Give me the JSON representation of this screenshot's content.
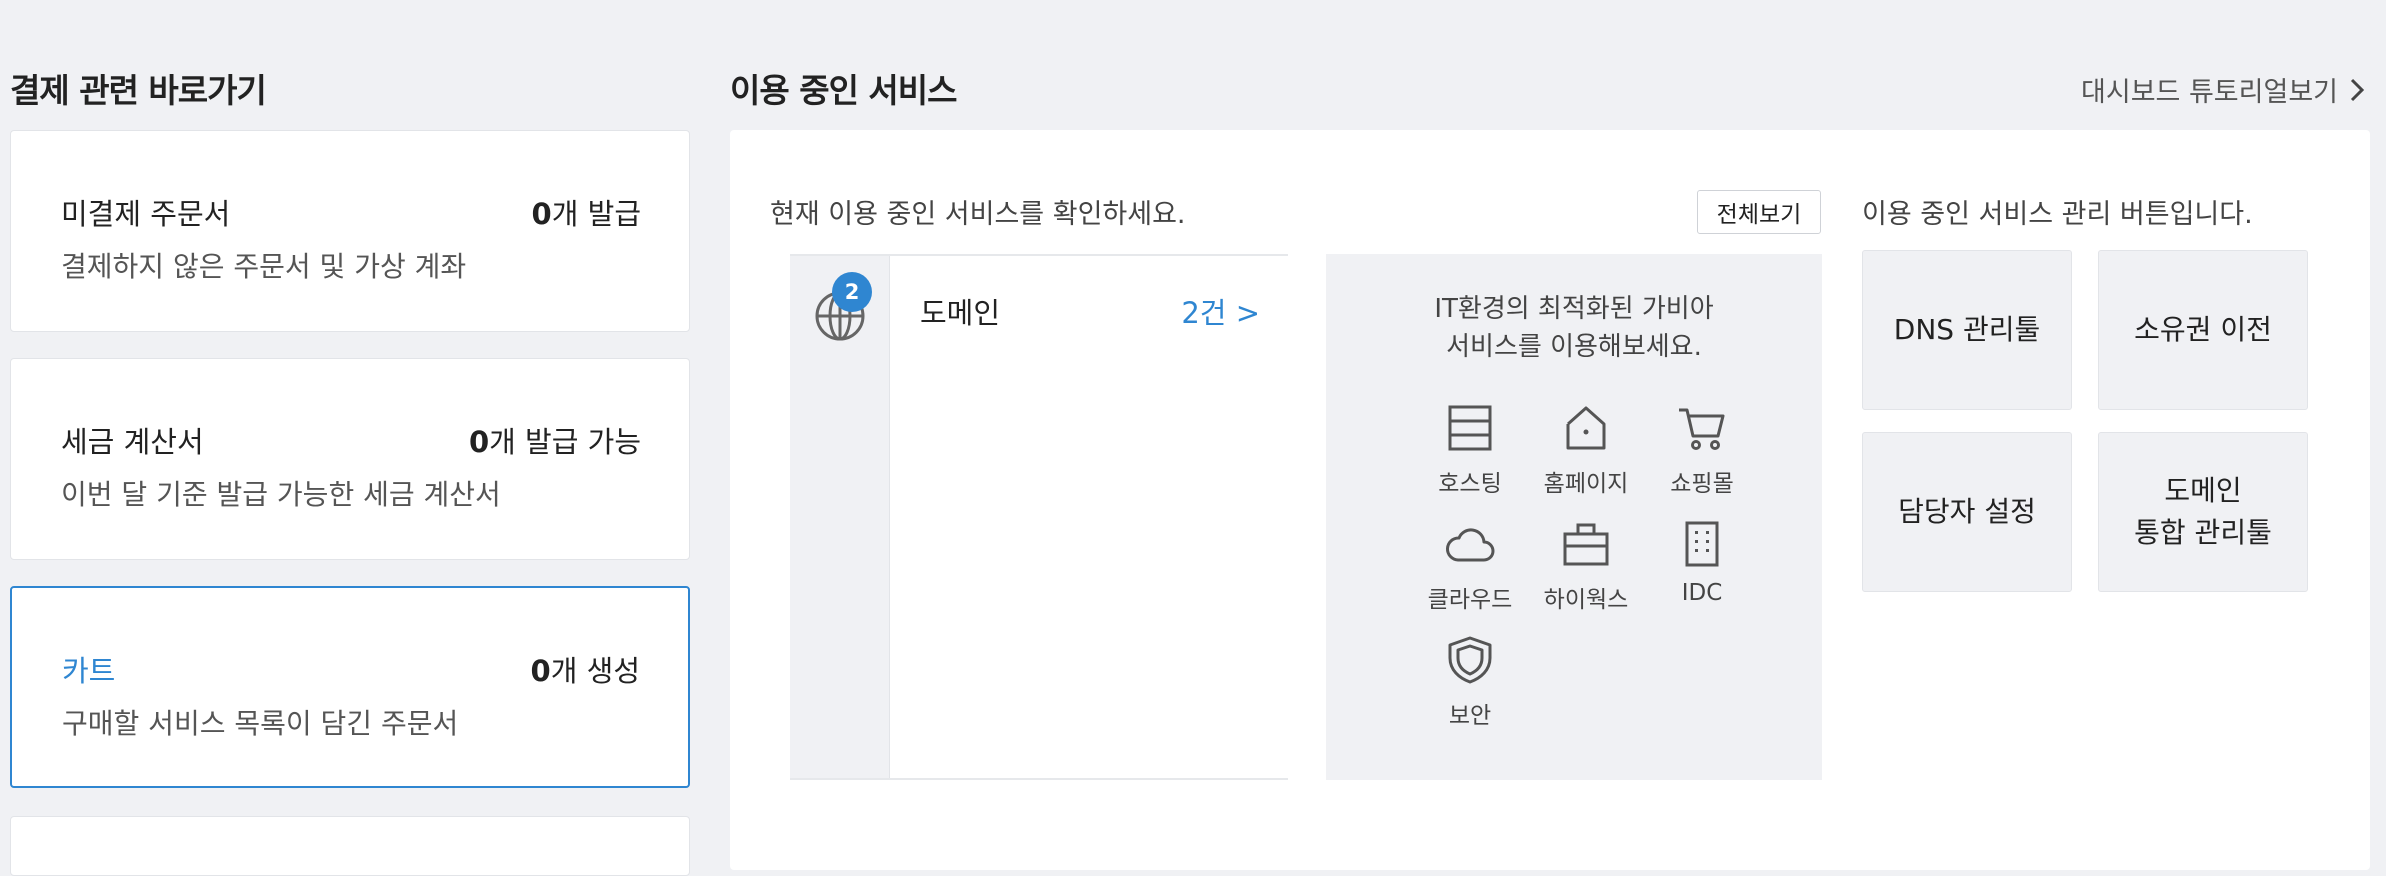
{
  "left": {
    "title": "결제 관련 바로가기",
    "cards": [
      {
        "title": "미결제 주문서",
        "count_num": "0",
        "count_suffix": "개 발급",
        "desc": "결제하지 않은 주문서 및 가상 계좌"
      },
      {
        "title": "세금 계산서",
        "count_num": "0",
        "count_suffix": "개 발급 가능",
        "desc": "이번 달 기준 발급 가능한 세금 계산서"
      },
      {
        "title": "카트",
        "count_num": "0",
        "count_suffix": "개 생성",
        "desc": "구매할 서비스 목록이 담긴 주문서"
      }
    ]
  },
  "main": {
    "title": "이용 중인 서비스",
    "tutorial_link": "대시보드 튜토리얼보기",
    "intro": "현재 이용 중인 서비스를 확인하세요.",
    "view_all": "전체보기",
    "service": {
      "badge": "2",
      "label": "도메인",
      "count": "2건 >"
    },
    "promo": {
      "line1": "IT환경의 최적화된 가비아",
      "line2": "서비스를 이용해보세요.",
      "items": [
        "호스팅",
        "홈페이지",
        "쇼핑몰",
        "클라우드",
        "하이웍스",
        "IDC",
        "보안"
      ]
    },
    "management": {
      "intro": "이용 중인 서비스 관리 버튼입니다.",
      "buttons": {
        "dns": "DNS 관리툴",
        "transfer": "소유권 이전",
        "contact": "담당자 설정",
        "integrated_line1": "도메인",
        "integrated_line2": "통합 관리툴"
      }
    }
  },
  "colors": {
    "accent": "#2f86d1",
    "background": "#f0f1f4",
    "panel": "#ffffff"
  },
  "icons": [
    "chevron-right-icon",
    "globe-icon",
    "hosting-icon",
    "homepage-icon",
    "shopping-cart-icon",
    "cloud-icon",
    "briefcase-icon",
    "building-icon",
    "shield-icon"
  ]
}
